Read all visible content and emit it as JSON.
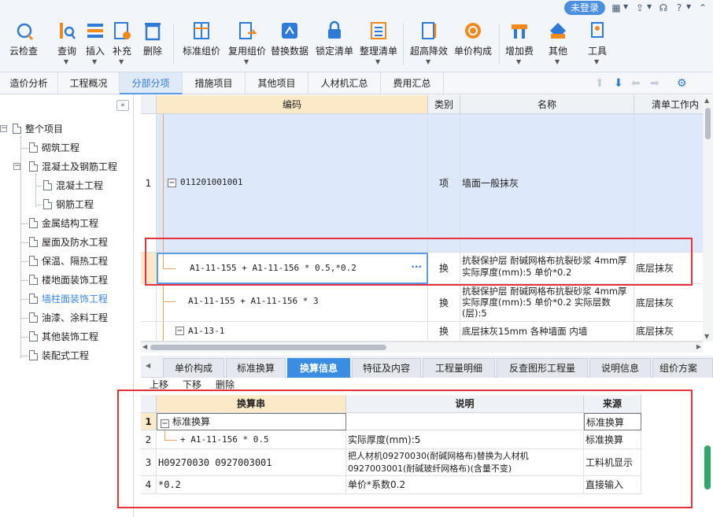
{
  "topbar": {
    "login_label": "未登录"
  },
  "ribbon": {
    "buttons": [
      {
        "label": "云检查",
        "icon": "cloud-check-icon",
        "dropdown": false
      },
      {
        "label": "查询",
        "icon": "query-icon",
        "dropdown": true
      },
      {
        "label": "插入",
        "icon": "insert-icon",
        "dropdown": true
      },
      {
        "label": "补充",
        "icon": "supplement-icon",
        "dropdown": true
      },
      {
        "label": "删除",
        "icon": "delete-icon",
        "dropdown": false
      },
      {
        "label": "标准组价",
        "icon": "standard-price-icon",
        "dropdown": false
      },
      {
        "label": "复用组价",
        "icon": "reuse-price-icon",
        "dropdown": true
      },
      {
        "label": "替换数据",
        "icon": "replace-data-icon",
        "dropdown": false
      },
      {
        "label": "锁定清单",
        "icon": "lock-icon",
        "dropdown": false
      },
      {
        "label": "整理清单",
        "icon": "organize-list-icon",
        "dropdown": true
      },
      {
        "label": "超高降效",
        "icon": "super-high-icon",
        "dropdown": true
      },
      {
        "label": "单价构成",
        "icon": "unit-price-icon",
        "dropdown": false
      },
      {
        "label": "增加费",
        "icon": "add-fee-icon",
        "dropdown": true
      },
      {
        "label": "其他",
        "icon": "other-icon",
        "dropdown": true
      },
      {
        "label": "工具",
        "icon": "tools-icon",
        "dropdown": true
      }
    ]
  },
  "module_tabs": [
    "造价分析",
    "工程概况",
    "分部分项",
    "措施项目",
    "其他项目",
    "人材机汇总",
    "费用汇总"
  ],
  "tree": {
    "root": "整个项目",
    "items": [
      {
        "label": "砌筑工程",
        "level": 1
      },
      {
        "label": "混凝土及钢筋工程",
        "level": 1,
        "expanded": true
      },
      {
        "label": "混凝土工程",
        "level": 2
      },
      {
        "label": "钢筋工程",
        "level": 2
      },
      {
        "label": "金属结构工程",
        "level": 1
      },
      {
        "label": "屋面及防水工程",
        "level": 1
      },
      {
        "label": "保温、隔热工程",
        "level": 1
      },
      {
        "label": "楼地面装饰工程",
        "level": 1
      },
      {
        "label": "墙柱面装饰工程",
        "level": 1,
        "selected": true
      },
      {
        "label": "油漆、涂料工程",
        "level": 1
      },
      {
        "label": "其他装饰工程",
        "level": 1
      },
      {
        "label": "装配式工程",
        "level": 1
      }
    ]
  },
  "main_grid": {
    "headers": {
      "code": "编码",
      "type": "类别",
      "name": "名称",
      "work": "清单工作内"
    },
    "rows": [
      {
        "no": "1",
        "code": "011201001001",
        "type": "项",
        "name": "墙面一般抹灰",
        "work": ""
      },
      {
        "no": "",
        "code": "A1-11-155 + A1-11-156 * 0.5,*0.2",
        "type": "换",
        "name": "抗裂保护层 耐碱网格布抗裂砂浆 4mm厚\n实际厚度(mm):5  单价*0.2",
        "work": "底层抹灰"
      },
      {
        "no": "",
        "code": "A1-11-155 + A1-11-156 * 3",
        "type": "换",
        "name": "抗裂保护层 耐碱网格布抗裂砂浆 4mm厚\n实际厚度(mm):5  单价*0.2  实际层数\n(层):5",
        "work": "底层抹灰"
      },
      {
        "no": "",
        "code": "A1-13-1",
        "type": "换",
        "name": "底层抹灰15mm 各种墙面 内墙",
        "work": "底层抹灰"
      }
    ]
  },
  "bottom_tabs": [
    "单价构成",
    "标准换算",
    "换算信息",
    "特征及内容",
    "工程量明细",
    "反查图形工程量",
    "说明信息",
    "组价方案"
  ],
  "ops": {
    "up": "上移",
    "down": "下移",
    "delete": "删除"
  },
  "sub_grid": {
    "headers": {
      "str": "换算串",
      "desc": "说明",
      "src": "来源"
    },
    "rows": [
      {
        "no": "1",
        "str": "标准换算",
        "desc": "",
        "src": "标准换算"
      },
      {
        "no": "2",
        "str": "+ A1-11-156 * 0.5",
        "desc": "实际厚度(mm):5",
        "src": "标准换算"
      },
      {
        "no": "3",
        "str": "H09270030 0927003001",
        "desc": "把人材机09270030(耐碱网格布)替换为人材机\n0927003001(耐碱玻纤网格布)(含量不变)",
        "src": "工料机显示"
      },
      {
        "no": "4",
        "str": "*0.2",
        "desc": "单价*系数0.2",
        "src": "直接输入"
      }
    ]
  },
  "colors": {
    "accent": "#3a8de0",
    "highlight_border": "#e8303a",
    "selected_row": "#dde8fa"
  }
}
